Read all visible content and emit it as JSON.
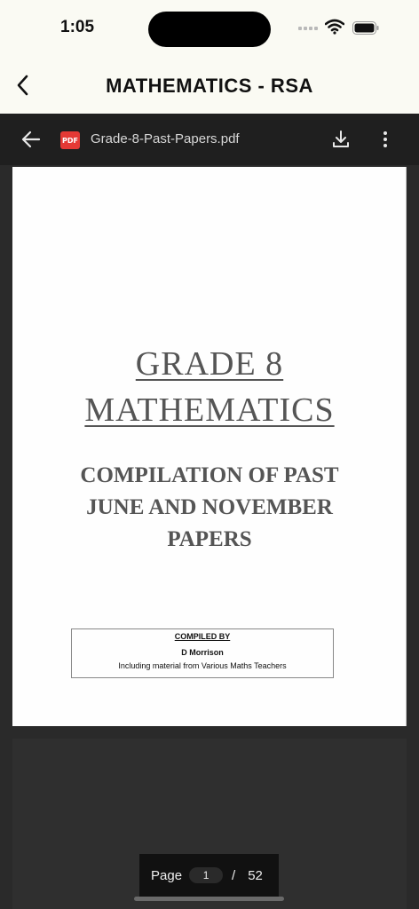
{
  "status_bar": {
    "time": "1:05"
  },
  "header": {
    "title": "MATHEMATICS - RSA"
  },
  "toolbar": {
    "file_icon_label": "PDF",
    "file_name": "Grade-8-Past-Papers.pdf"
  },
  "document": {
    "title_line1": "GRADE 8",
    "title_line2": "MATHEMATICS",
    "subtitle_line1": "COMPILATION OF PAST",
    "subtitle_line2": "JUNE AND NOVEMBER",
    "subtitle_line3": "PAPERS",
    "compiled_label": "COMPILED BY",
    "compiled_name": "D Morrison",
    "compiled_note": "Including material from Various Maths Teachers"
  },
  "pager": {
    "label": "Page",
    "current": "1",
    "separator": "/",
    "total": "52"
  },
  "colors": {
    "pdf_badge": "#e53935",
    "toolbar_bg": "#1f1f1f",
    "header_bg": "#fafaf3",
    "viewer_bg": "#2a2a2a"
  }
}
